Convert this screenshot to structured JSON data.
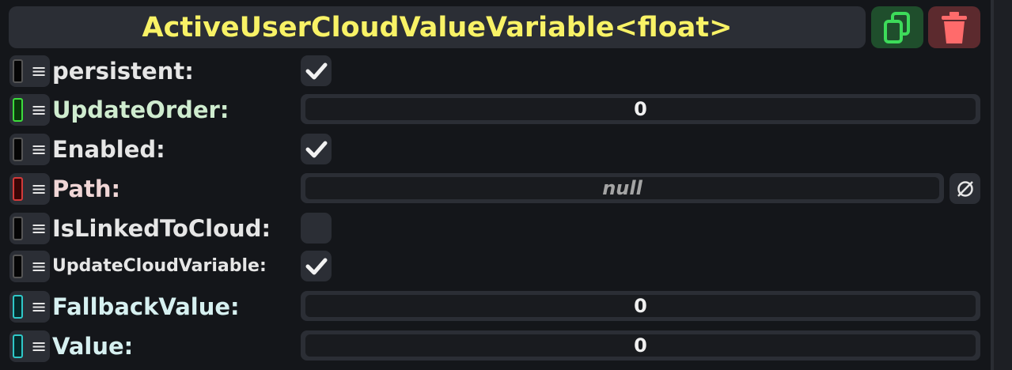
{
  "header": {
    "title": "ActiveUserCloudValueVariable<float>",
    "duplicate_icon": "duplicate-icon",
    "delete_icon": "trash-icon",
    "colors": {
      "title": "#f8f266",
      "duplicate": "#3ddc5a",
      "delete": "#ff6b6b"
    }
  },
  "fields": [
    {
      "label": "persistent:",
      "type": "checkbox",
      "checked": true,
      "swatch": "#050505",
      "swatch_border": "#555555",
      "label_color": "#e6e6e6"
    },
    {
      "label": "UpdateOrder:",
      "type": "number",
      "value": "0",
      "swatch": "#0a3a0a",
      "swatch_border": "#3ddc3d",
      "label_color": "#cfeccf"
    },
    {
      "label": "Enabled:",
      "type": "checkbox",
      "checked": true,
      "swatch": "#050505",
      "swatch_border": "#555555",
      "label_color": "#e6e6e6"
    },
    {
      "label": "Path:",
      "type": "reference",
      "value": "null",
      "swatch": "#3a0505",
      "swatch_border": "#d23a3a",
      "label_color": "#f0d6d6",
      "clear_icon": "null-icon"
    },
    {
      "label": "IsLinkedToCloud:",
      "type": "checkbox",
      "checked": false,
      "swatch": "#050505",
      "swatch_border": "#555555",
      "label_color": "#e6e6e6"
    },
    {
      "label": "UpdateCloudVariable:",
      "type": "checkbox",
      "checked": true,
      "swatch": "#050505",
      "swatch_border": "#555555",
      "label_color": "#e6e6e6"
    },
    {
      "label": "FallbackValue:",
      "type": "number",
      "value": "0",
      "swatch": "#052a2a",
      "swatch_border": "#2fc8c8",
      "label_color": "#d6f0f0"
    },
    {
      "label": "Value:",
      "type": "number",
      "value": "0",
      "swatch": "#052a2a",
      "swatch_border": "#2fc8c8",
      "label_color": "#d6f0f0"
    }
  ]
}
